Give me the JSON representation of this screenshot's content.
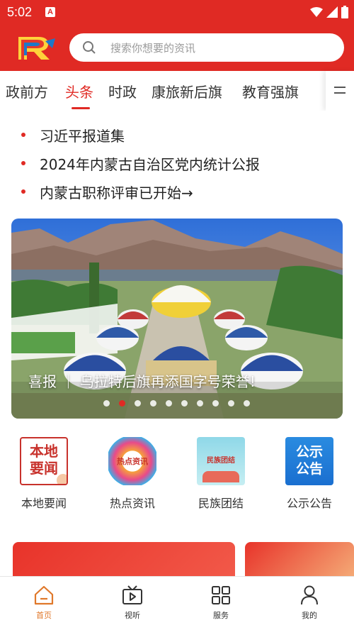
{
  "status": {
    "time": "5:02",
    "a_icon": "A"
  },
  "search": {
    "placeholder": "搜索你想要的资讯"
  },
  "tabs": [
    {
      "label": "政前方"
    },
    {
      "label": "头条",
      "active": true
    },
    {
      "label": "时政"
    },
    {
      "label": "康旅新后旗"
    },
    {
      "label": "教育强旗"
    }
  ],
  "headlines": [
    "习近平报道集",
    "2024年内蒙古自治区党内统计公报",
    "内蒙古职称评审已开始→"
  ],
  "banner": {
    "caption": "喜报 ｜ 乌拉特后旗再添国字号荣誉!",
    "slide_count": 10,
    "active_slide": 2
  },
  "quick_links": [
    {
      "label": "本地要闻",
      "icon_text": "本地\n要闻"
    },
    {
      "label": "热点资讯",
      "icon_text": "热点资讯"
    },
    {
      "label": "民族团结",
      "icon_text": "民族团结"
    },
    {
      "label": "公示公告",
      "icon_text": "公示\n公告"
    }
  ],
  "bottom_nav": [
    {
      "label": "首页",
      "icon": "home-icon",
      "active": true
    },
    {
      "label": "视听",
      "icon": "video-icon"
    },
    {
      "label": "服务",
      "icon": "grid-icon"
    },
    {
      "label": "我的",
      "icon": "user-icon"
    }
  ],
  "colors": {
    "brand_red": "#e02a24",
    "nav_active": "#e0782a",
    "notice_blue": "#1a6fd0"
  }
}
